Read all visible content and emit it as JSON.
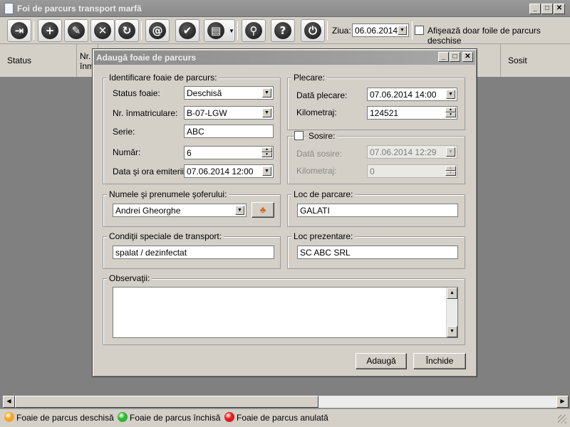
{
  "window": {
    "title": "Foi de parcurs transport marfă"
  },
  "toolbar": {
    "buttons": [
      {
        "icon": "exit-icon",
        "glyph": "⇥"
      },
      {
        "icon": "add-icon",
        "glyph": "+"
      },
      {
        "icon": "edit-icon",
        "glyph": "✎"
      },
      {
        "icon": "delete-icon",
        "glyph": "✕"
      },
      {
        "icon": "refresh-icon",
        "glyph": "↻"
      },
      {
        "icon": "email-icon",
        "glyph": "@"
      },
      {
        "icon": "validate-icon",
        "glyph": "✔"
      },
      {
        "icon": "print-icon",
        "glyph": "▤"
      },
      {
        "icon": "search-icon",
        "glyph": "⚲"
      },
      {
        "icon": "help-icon",
        "glyph": "?"
      },
      {
        "icon": "power-icon",
        "glyph": "⏻"
      }
    ],
    "date_label": "Ziua:",
    "date_value": "06.06.2014",
    "open_only_label": "Afişează doar foile de parcurs deschise"
  },
  "grid": {
    "columns": [
      "Status",
      "Nr.",
      "înm",
      "Sosit"
    ]
  },
  "dialog": {
    "title": "Adaugă foaie de parcurs",
    "ident": {
      "title": "Identificare foaie de parcurs:",
      "status_label": "Status foaie:",
      "status_value": "Deschisă",
      "plate_label": "Nr. înmatriculare:",
      "plate_value": "B-07-LGW",
      "series_label": "Serie:",
      "series_value": "ABC",
      "number_label": "Număr:",
      "number_value": "6",
      "issue_label": "Data şi ora emiterii:",
      "issue_value": "07.06.2014 12:00"
    },
    "departure": {
      "title": "Plecare:",
      "date_label": "Dată plecare:",
      "date_value": "07.06.2014 14:00",
      "km_label": "Kilometraj:",
      "km_value": "124521"
    },
    "arrival": {
      "title": "Sosire:",
      "date_label": "Dată sosire:",
      "date_value": "07.06.2014 12:29",
      "km_label": "Kilometraj:",
      "km_value": "0"
    },
    "driver": {
      "title": "Numele şi prenumele şoferului:",
      "value": "Andrei Gheorghe"
    },
    "parking": {
      "title": "Loc de parcare:",
      "value": "GALATI"
    },
    "conditions": {
      "title": "Condiţii speciale de transport:",
      "value": "spalat / dezinfectat"
    },
    "presentation": {
      "title": "Loc prezentare:",
      "value": "SC ABC SRL"
    },
    "notes": {
      "title": "Observaţii:",
      "value": ""
    },
    "add_button": "Adaugă",
    "close_button": "Închide"
  },
  "legend": [
    {
      "label": "Foaie de parcus deschisă",
      "color": "#f5a623"
    },
    {
      "label": "Foaie de parcus închisă",
      "color": "#2db82d"
    },
    {
      "label": "Foaie de parcus anulată",
      "color": "#e01b1b"
    }
  ]
}
